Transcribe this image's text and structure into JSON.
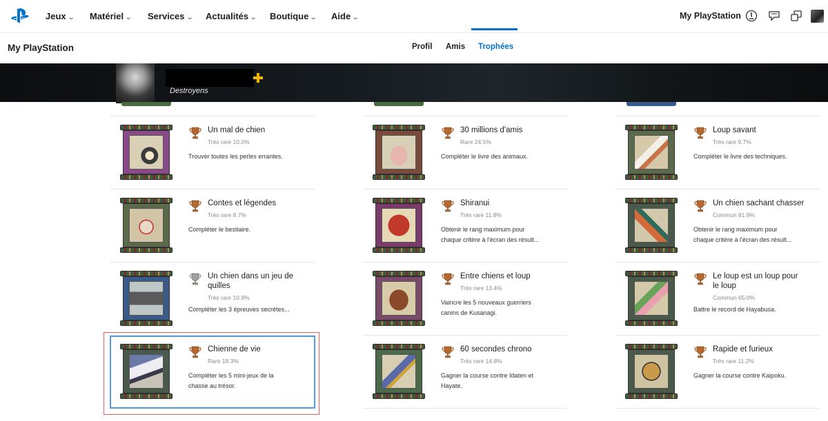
{
  "nav": {
    "items": [
      {
        "label": "Jeux"
      },
      {
        "label": "Matériel"
      },
      {
        "label": "Services"
      },
      {
        "label": "Actualités"
      },
      {
        "label": "Boutique"
      },
      {
        "label": "Aide"
      }
    ],
    "my_playstation": "My PlayStation"
  },
  "subheader": {
    "title": "My PlayStation",
    "tabs": [
      {
        "label": "Profil"
      },
      {
        "label": "Amis"
      },
      {
        "label": "Trophées"
      }
    ],
    "active_tab": "Trophées"
  },
  "profile": {
    "username": "Destroyens"
  },
  "colors": {
    "accent": "#0072ce",
    "bronze": "#b5692e",
    "silver": "#9ea3a8",
    "selection_border": "#4f9de8",
    "highlight_border": "#e06060"
  },
  "trophies": [
    {
      "name": "Un mal de chien",
      "rarity": "Très rare 10.0%",
      "desc": "Trouver toutes les perles errantes.",
      "type": "bronze",
      "art": "serpent-scroll"
    },
    {
      "name": "30 millions d'amis",
      "rarity": "Rare 24.5%",
      "desc": "Compléter le livre des animaux.",
      "type": "bronze",
      "art": "pig-scroll"
    },
    {
      "name": "Loup savant",
      "rarity": "Très rare 9.7%",
      "desc": "Compléter le livre des techniques.",
      "type": "bronze",
      "art": "wolf-brush-scroll"
    },
    {
      "name": "Contes et légendes",
      "rarity": "Très rare 8.7%",
      "desc": "Compléter le bestiaire.",
      "type": "bronze",
      "art": "demon-scroll"
    },
    {
      "name": "Shiranui",
      "rarity": "Très rare 11.8%",
      "desc": "Obtenir le rang maximum pour",
      "desc2": "chaque critère à l'écran des résult...",
      "type": "bronze",
      "art": "sun-scroll"
    },
    {
      "name": "Un chien sachant chasser",
      "rarity": "Commun 81.9%",
      "desc": "Obtenir le rang maximum pour",
      "desc2": "chaque critère à l'écran des résult...",
      "type": "bronze",
      "art": "bird-scroll"
    },
    {
      "name": "Un chien dans un jeu de",
      "name2": "quilles",
      "rarity": "Très rare 10.9%",
      "desc": "Compléter les 3 épreuves secrètes...",
      "type": "silver",
      "art": "machine-scroll"
    },
    {
      "name": "Entre chiens et loup",
      "rarity": "Très rare 13.4%",
      "desc": "Vaincre les 5 nouveaux guerriers",
      "desc2": "canins de Kusanagi.",
      "type": "bronze",
      "art": "dog-scroll"
    },
    {
      "name": "Le loup est un loup pour",
      "name2": "le loup",
      "rarity": "Commun 65.0%",
      "desc": "Battre le record de Hayabusa.",
      "type": "bronze",
      "art": "radish-scroll"
    },
    {
      "name": "Chienne de vie",
      "rarity": "Rare 18.3%",
      "desc": "Compléter les 5 mini-jeux de la",
      "desc2": "chasse au trésor.",
      "type": "bronze",
      "art": "wolf-scroll"
    },
    {
      "name": "60 secondes chrono",
      "rarity": "Très rare 14.8%",
      "desc": "Gagner la course contre Idaten et",
      "desc2": "Hayate.",
      "type": "bronze",
      "art": "runner-scroll"
    },
    {
      "name": "Rapide et furieux",
      "rarity": "Très rare 11.2%",
      "desc": "Gagner la course contre Kaipoku.",
      "type": "bronze",
      "art": "mask-scroll"
    }
  ]
}
